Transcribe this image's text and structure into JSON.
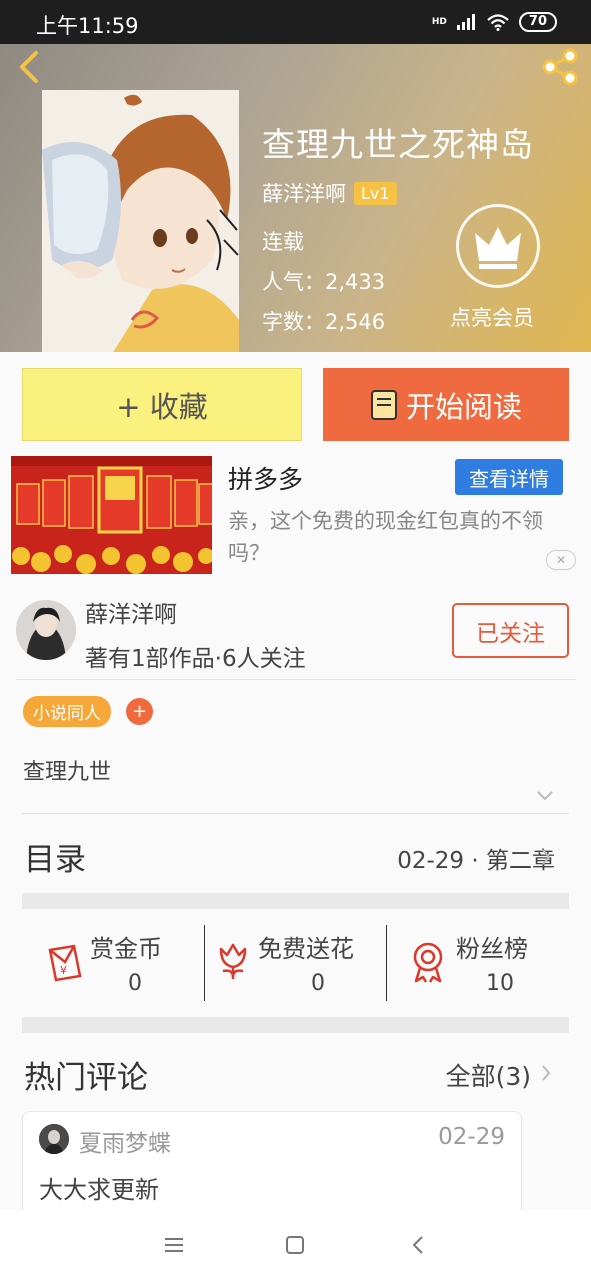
{
  "status_bar": {
    "time": "上午11:59",
    "network": "HD",
    "battery": "70"
  },
  "book": {
    "title": "查理九世之死神岛",
    "author": "薛洋洋啊",
    "level": "Lv1",
    "status": "连载",
    "popularity": "人气：2,433",
    "word_count": "字数：2,546"
  },
  "vip": {
    "label": "点亮会员"
  },
  "actions": {
    "collect": "+ 收藏",
    "read": "开始阅读"
  },
  "ad": {
    "title": "拼多多",
    "button": "查看详情",
    "description": "亲，这个免费的现金红包真的不领吗？",
    "close": "✕"
  },
  "author_card": {
    "name": "薛洋洋啊",
    "stats": "著有1部作品·6人关注",
    "follow": "已关注"
  },
  "tags": {
    "category": "小说同人",
    "add": "+"
  },
  "synopsis": "查理九世",
  "toc": {
    "title": "目录",
    "latest": "02-29 · 第二章"
  },
  "stats": [
    {
      "label": "赏金币",
      "value": "0",
      "icon": "red-envelope-icon"
    },
    {
      "label": "免费送花",
      "value": "0",
      "icon": "flower-icon"
    },
    {
      "label": "粉丝榜",
      "value": "10",
      "icon": "medal-icon"
    }
  ],
  "comments": {
    "title": "热门评论",
    "all_label": "全部(3)",
    "items": [
      {
        "user": "夏雨梦蝶",
        "date": "02-29",
        "text": "大大求更新"
      }
    ]
  },
  "colors": {
    "accent": "#ef6a3f",
    "collect": "#fbf17e",
    "tag": "#f5a73a",
    "ad_button": "#2f7de1"
  }
}
